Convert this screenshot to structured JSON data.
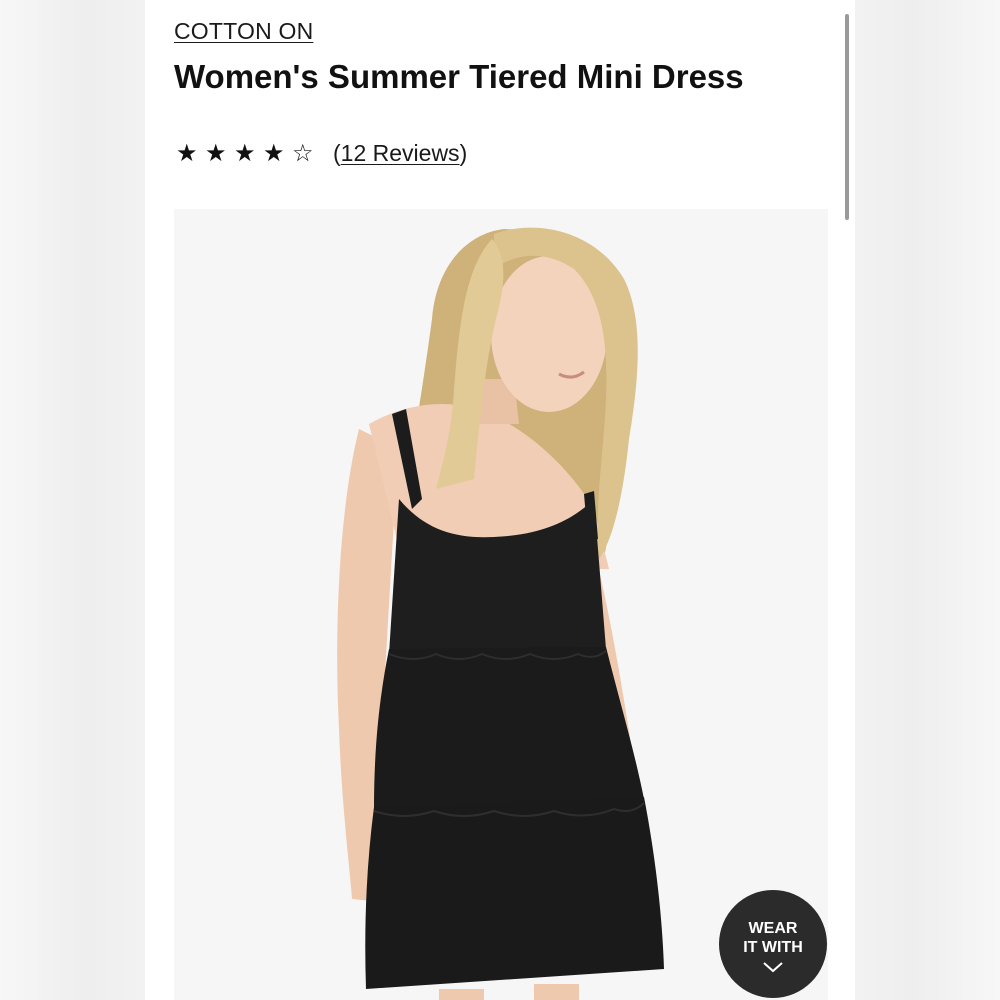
{
  "product": {
    "brand": "COTTON ON",
    "title": "Women's Summer Tiered Mini Dress",
    "rating": {
      "value": 4,
      "max": 5,
      "reviews_label": "12 Reviews",
      "open_paren": "(",
      "close_paren": ")"
    },
    "image": {
      "description_icon": "product-photo",
      "background_color": "#f6f6f6",
      "dress_color": "#1c1c1c",
      "hair_color": "#d9c08a",
      "skin_color": "#f0cdb4"
    }
  },
  "wear_with": {
    "label": "WEAR\nIT WITH",
    "icon": "chevron-down-icon",
    "color": "#2b2b2b"
  },
  "colors": {
    "text": "#111111",
    "page_bg": "#ffffff",
    "outer_bg": "#f0f0f0"
  }
}
